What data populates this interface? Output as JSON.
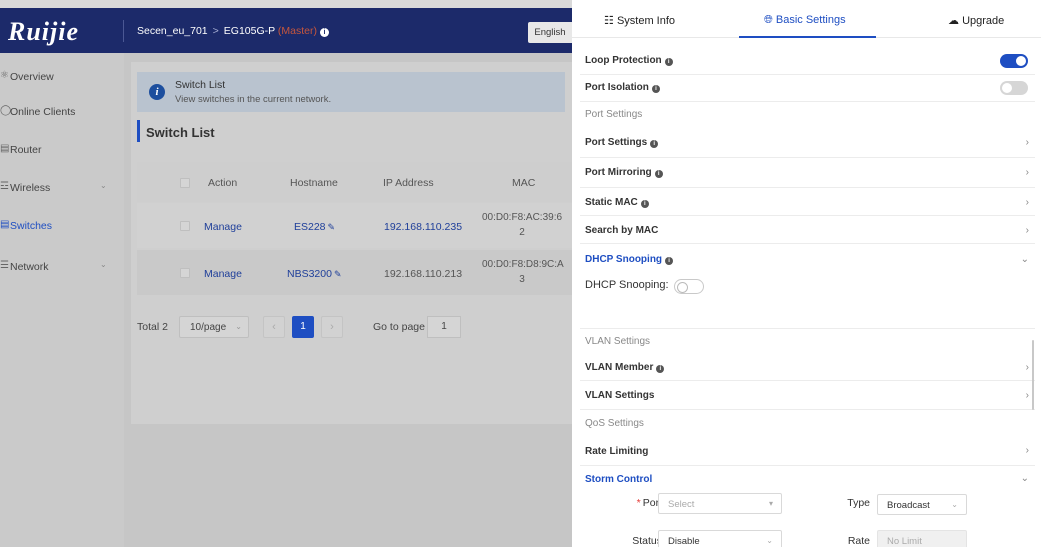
{
  "header": {
    "logo": "Ruijie",
    "site": "Secen_eu_701",
    "device": "EG105G-P",
    "role": "(Master)",
    "language": "English"
  },
  "sidebar": {
    "items": [
      {
        "label": "Overview",
        "icon": "network-icon"
      },
      {
        "label": "Online Clients",
        "icon": "clients-icon"
      },
      {
        "label": "Router",
        "icon": "router-icon"
      },
      {
        "label": "Wireless",
        "icon": "wifi-icon"
      },
      {
        "label": "Switches",
        "icon": "switch-icon"
      },
      {
        "label": "Network",
        "icon": "network-settings-icon"
      }
    ]
  },
  "main": {
    "alert_title": "Switch List",
    "alert_desc": "View switches in the current network.",
    "section_title": "Switch List",
    "columns": [
      "Action",
      "Hostname",
      "IP Address",
      "MAC"
    ],
    "rows": [
      {
        "action": "Manage",
        "hostname": "ES228",
        "ip": "192.168.110.235",
        "mac1": "00:D0:F8:AC:39:6",
        "mac2": "2"
      },
      {
        "action": "Manage",
        "hostname": "NBS3200",
        "ip": "192.168.110.213",
        "mac1": "00:D0:F8:D8:9C:A",
        "mac2": "3"
      }
    ],
    "pager": {
      "total": "Total 2",
      "page_size": "10/page",
      "current": "1",
      "goto_label": "Go to page",
      "goto_value": "1"
    }
  },
  "drawer": {
    "tabs": [
      "System Info",
      "Basic Settings",
      "Upgrade"
    ],
    "active_tab": "Basic Settings",
    "loop_protection": "Loop Protection",
    "port_isolation": "Port Isolation",
    "port_settings_group": "Port Settings",
    "port_settings": "Port Settings",
    "port_mirroring": "Port Mirroring",
    "static_mac": "Static MAC",
    "search_by_mac": "Search by MAC",
    "dhcp_snooping": "DHCP Snooping",
    "dhcp_snooping_field": "DHCP Snooping:",
    "vlan_settings_group": "VLAN Settings",
    "vlan_member": "VLAN Member",
    "vlan_settings": "VLAN Settings",
    "qos_group": "QoS Settings",
    "rate_limiting": "Rate Limiting",
    "storm_control": "Storm Control",
    "form": {
      "port_label": "Port",
      "port_placeholder": "Select",
      "type_label": "Type",
      "type_value": "Broadcast",
      "status_label": "Status",
      "status_value": "Disable",
      "rate_label": "Rate",
      "rate_placeholder": "No Limit"
    },
    "toggles": {
      "loop_protection": true,
      "port_isolation": false,
      "dhcp_snooping": false
    }
  },
  "colors": {
    "accent": "#1e4ec2",
    "header": "#1c2a6a",
    "required": "#e53935"
  }
}
